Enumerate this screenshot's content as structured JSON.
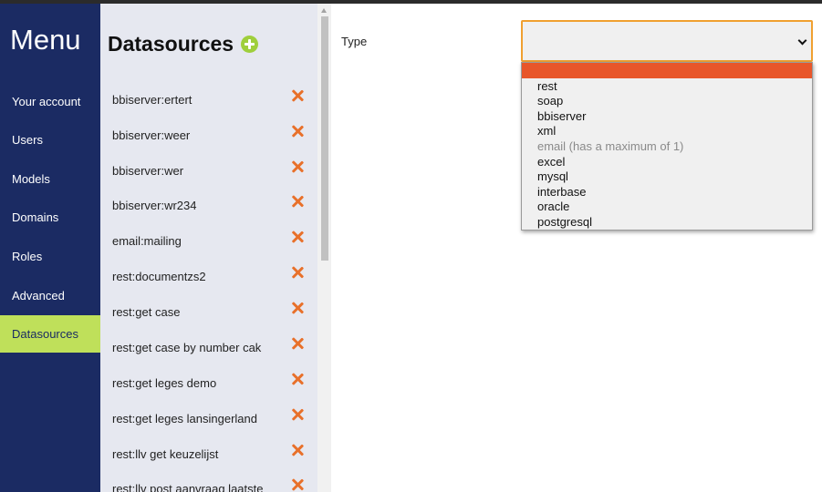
{
  "menu": {
    "title": "Menu",
    "items": [
      {
        "label": "Your account"
      },
      {
        "label": "Users"
      },
      {
        "label": "Models"
      },
      {
        "label": "Domains"
      },
      {
        "label": "Roles"
      },
      {
        "label": "Advanced"
      },
      {
        "label": "Datasources"
      }
    ],
    "active_item": "Datasources"
  },
  "datasources": {
    "title": "Datasources",
    "items": [
      {
        "label": "bbiserver:ertert"
      },
      {
        "label": "bbiserver:weer"
      },
      {
        "label": "bbiserver:wer"
      },
      {
        "label": "bbiserver:wr234"
      },
      {
        "label": "email:mailing"
      },
      {
        "label": "rest:documentzs2"
      },
      {
        "label": "rest:get case"
      },
      {
        "label": "rest:get case by number cak"
      },
      {
        "label": "rest:get leges demo"
      },
      {
        "label": "rest:get leges lansingerland"
      },
      {
        "label": "rest:llv get keuzelijst"
      },
      {
        "label": "rest:llv post aanvraag laatste"
      }
    ]
  },
  "form": {
    "type_label": "Type",
    "type_select": {
      "selected": "",
      "options": [
        {
          "label": "",
          "disabled": false
        },
        {
          "label": "rest",
          "disabled": false
        },
        {
          "label": "soap",
          "disabled": false
        },
        {
          "label": "bbiserver",
          "disabled": false
        },
        {
          "label": "xml",
          "disabled": false
        },
        {
          "label": "email (has a maximum of 1)",
          "disabled": true
        },
        {
          "label": "excel",
          "disabled": false
        },
        {
          "label": "mysql",
          "disabled": false
        },
        {
          "label": "interbase",
          "disabled": false
        },
        {
          "label": "oracle",
          "disabled": false
        },
        {
          "label": "postgresql",
          "disabled": false
        }
      ]
    }
  },
  "colors": {
    "menu_bg": "#1b2b63",
    "active_bg": "#bfe05a",
    "panel_bg": "#e6e8f0",
    "delete_icon": "#e8702a",
    "add_icon": "#9fcf3c",
    "highlight": "#e8562a",
    "select_focus": "#f0a030"
  }
}
